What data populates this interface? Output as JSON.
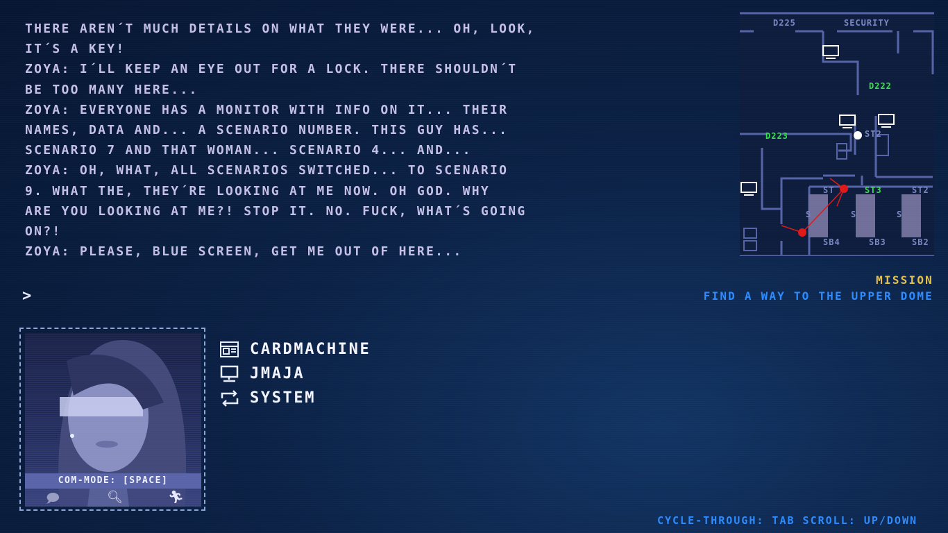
{
  "dialogue": [
    "THERE AREN´T MUCH DETAILS ON WHAT THEY WERE... OH, LOOK,",
    "IT´S A KEY!",
    "ZOYA: I´LL KEEP AN EYE OUT FOR A LOCK. THERE SHOULDN´T",
    "BE TOO MANY HERE...",
    "ZOYA: EVERYONE HAS A MONITOR WITH INFO ON IT... THEIR",
    "NAMES, DATA AND... A SCENARIO NUMBER. THIS GUY HAS...",
    "SCENARIO 7 AND THAT WOMAN... SCENARIO 4... AND...",
    "ZOYA: OH, WHAT, ALL SCENARIOS SWITCHED... TO SCENARIO",
    "9. WHAT THE, THEY´RE LOOKING AT ME NOW. OH GOD. WHY",
    "ARE YOU LOOKING AT ME?! STOP IT. NO. FUCK, WHAT´S GOING",
    "ON?!",
    "ZOYA: PLEASE, BLUE SCREEN, GET ME OUT OF HERE..."
  ],
  "prompt": ">",
  "mission": {
    "label": "MISSION",
    "text": "FIND A WAY TO THE UPPER DOME"
  },
  "portrait": {
    "com_mode": "COM-MODE: [SPACE]",
    "icons": [
      "speech-icon",
      "magnifier-icon",
      "running-figure-icon"
    ]
  },
  "menu": [
    {
      "label": "CARDMACHINE",
      "icon": "card-machine-icon"
    },
    {
      "label": "JMAJA",
      "icon": "computer-terminal-icon"
    },
    {
      "label": "SYSTEM",
      "icon": "cycle-arrows-icon"
    }
  ],
  "hint": "CYCLE-THROUGH: TAB SCROLL: UP/DOWN",
  "minimap": {
    "labels": {
      "d225": "D225",
      "security": "SECURITY",
      "d222": "D222",
      "d223": "D223",
      "st2_dim": "ST2",
      "st3": "ST3",
      "st1": "ST",
      "st2": "ST2",
      "sb4": "SB4",
      "sb3": "SB3",
      "sb2": "SB2",
      "s1": "S",
      "s2": "S",
      "s3": "S"
    },
    "colors": {
      "highlight": "#36e24a",
      "dim": "#7b86c4",
      "marker": "#e01818"
    }
  }
}
